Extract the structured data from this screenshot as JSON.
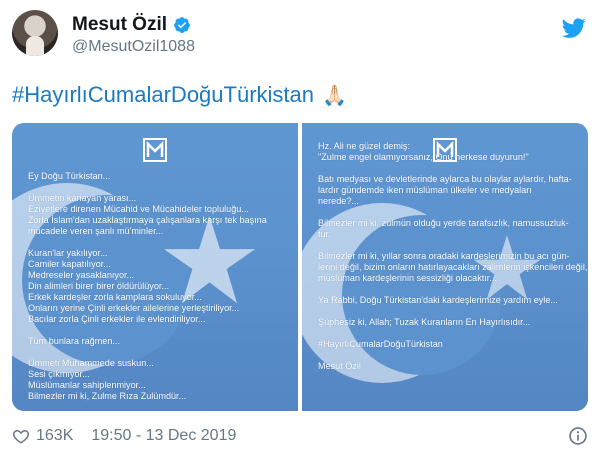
{
  "author": {
    "display_name": "Mesut Özil",
    "handle": "@MesutOzil1088",
    "verified": true,
    "avatar_icon": "profile-photo"
  },
  "brand_icon": "twitter-bird-icon",
  "tweet": {
    "text": "#HayırlıCumalarDoğuTürkistan",
    "emoji": "🙏🏻"
  },
  "media": {
    "left_panel_lines": [
      "Ey Doğu Türkistan...",
      "",
      "Ümmetin kanayan yarası...",
      "Eziyetlere direnen Mücahid ve Mücahideler topluluğu...",
      "Zorla İslam'dan uzaklaştırmaya çalışanlara karşı tek başına",
      "mücadele veren şanlı mü'minler...",
      "",
      "Kuran'lar yakılıyor...",
      "Camiler kapatılıyor...",
      "Medreseler yasaklanıyor...",
      "Din alimleri birer birer öldürülüyor...",
      "Erkek kardeşler zorla kamplara sokuluyor...",
      "Onların yerine Çinli erkekler ailelerine yerleştiriliyor...",
      "Bacılar zorla Çinli erkekler ile evlendiriliyor...",
      "",
      "Tüm bunlara rağmen...",
      "",
      "Ümmeti Muhammede suskun...",
      "Sesi çıkmıyor...",
      "Müslümanlar sahiplenmiyor...",
      "Bilmezler mi ki, Zulme Rıza Zulümdür..."
    ],
    "right_panel_lines": [
      "Hz. Ali ne güzel demiş:",
      "\"Zulme engel olamıyorsanız, Onu herkese duyurun!\"",
      "",
      "Batı medyası ve devletlerinde aylarca bu olaylar aylardır, hafta-",
      "lardır gündemde iken müslüman ülkeler ve medyaları",
      "nerede?...",
      "",
      "Bilmezler mi ki, zulmün olduğu yerde tarafsızlık, namussuzluk-",
      "tur.",
      "",
      "Bilmezler mi ki, yıllar sonra oradaki kardeşlerimizin bu acı gün-",
      "lerini değil, bizim onların hatırlayacakları zalimlerin işkencileri değil,",
      "müslüman kardeşlerinin sessizliği olacaktır...",
      "",
      "Ya Rabbi, Doğu Türkistan'daki kardeşlerimize yardım eyle...",
      "",
      "Şüphesiz ki, Allah; Tuzak Kuranların En Hayırlısıdır...",
      "",
      "#HayırlıCumalarDoğuTürkistan",
      "",
      "Mesut Özil"
    ],
    "flag_color": "#5b91cd"
  },
  "footer": {
    "likes": "163K",
    "timestamp": "19:50 - 13 Dec 2019"
  },
  "colors": {
    "link": "#1b7ac4",
    "twitter_blue": "#1da1f2",
    "muted": "#657786"
  }
}
